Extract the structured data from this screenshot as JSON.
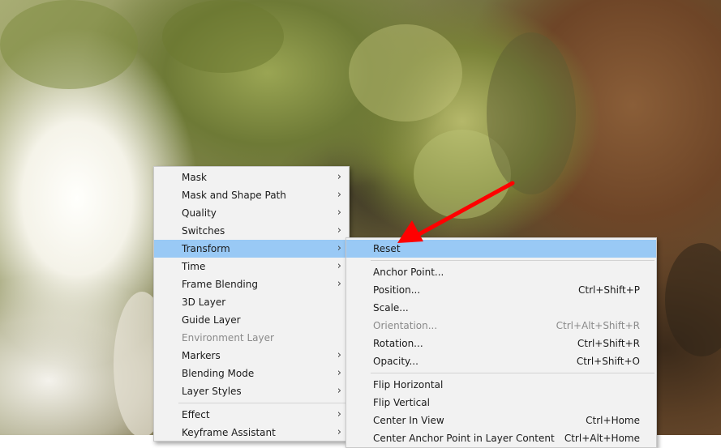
{
  "main_menu": {
    "items": [
      {
        "label": "Mask",
        "submenu": true
      },
      {
        "label": "Mask and Shape Path",
        "submenu": true
      },
      {
        "label": "Quality",
        "submenu": true
      },
      {
        "label": "Switches",
        "submenu": true
      },
      {
        "label": "Transform",
        "submenu": true,
        "highlighted": true
      },
      {
        "label": "Time",
        "submenu": true
      },
      {
        "label": "Frame Blending",
        "submenu": true
      },
      {
        "label": "3D Layer",
        "submenu": false
      },
      {
        "label": "Guide Layer",
        "submenu": false
      },
      {
        "label": "Environment Layer",
        "submenu": false,
        "disabled": true
      },
      {
        "label": "Markers",
        "submenu": true
      },
      {
        "label": "Blending Mode",
        "submenu": true
      },
      {
        "label": "Layer Styles",
        "submenu": true
      },
      {
        "separator": true
      },
      {
        "label": "Effect",
        "submenu": true
      },
      {
        "label": "Keyframe Assistant",
        "submenu": true
      }
    ]
  },
  "transform_submenu": {
    "items": [
      {
        "label": "Reset",
        "shortcut": "",
        "highlighted": true
      },
      {
        "separator": true
      },
      {
        "label": "Anchor Point...",
        "shortcut": ""
      },
      {
        "label": "Position...",
        "shortcut": "Ctrl+Shift+P"
      },
      {
        "label": "Scale...",
        "shortcut": ""
      },
      {
        "label": "Orientation...",
        "shortcut": "Ctrl+Alt+Shift+R",
        "disabled": true
      },
      {
        "label": "Rotation...",
        "shortcut": "Ctrl+Shift+R"
      },
      {
        "label": "Opacity...",
        "shortcut": "Ctrl+Shift+O"
      },
      {
        "separator": true
      },
      {
        "label": "Flip Horizontal",
        "shortcut": ""
      },
      {
        "label": "Flip Vertical",
        "shortcut": ""
      },
      {
        "label": "Center In View",
        "shortcut": "Ctrl+Home"
      },
      {
        "label": "Center Anchor Point in Layer Content",
        "shortcut": "Ctrl+Alt+Home"
      }
    ]
  },
  "icons": {
    "submenu_arrow": "›"
  },
  "colors": {
    "menu_bg": "#f2f2f2",
    "highlight": "#99c9f5",
    "disabled_text": "#8a8a8a",
    "annotation_arrow": "#ff0000"
  }
}
